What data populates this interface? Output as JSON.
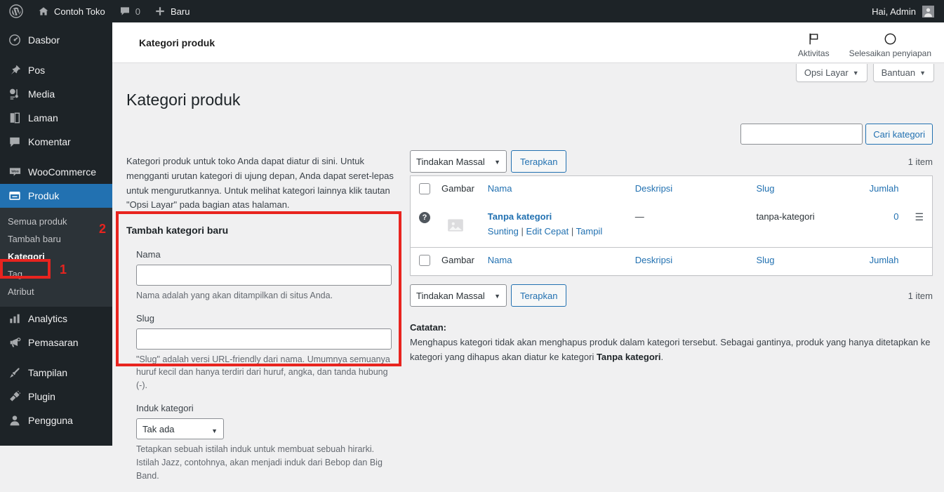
{
  "adminbar": {
    "logo_icon": "wordpress-logo-icon",
    "site_icon": "home-icon",
    "site_name": "Contoh Toko",
    "comments_icon": "comment-bubble-icon",
    "comments_count": "0",
    "new_icon": "plus-icon",
    "new_label": "Baru",
    "greeting": "Hai, Admin",
    "avatar_icon": "user-avatar-icon"
  },
  "sidebar": {
    "items": [
      {
        "label": "Dasbor",
        "icon": "dashboard-icon",
        "current": false
      },
      {
        "label": "Pos",
        "icon": "pin-icon",
        "current": false
      },
      {
        "label": "Media",
        "icon": "media-icon",
        "current": false
      },
      {
        "label": "Laman",
        "icon": "page-icon",
        "current": false
      },
      {
        "label": "Komentar",
        "icon": "comment-icon",
        "current": false
      },
      {
        "label": "WooCommerce",
        "icon": "woocommerce-icon",
        "current": false
      },
      {
        "label": "Produk",
        "icon": "products-box-icon",
        "current": true
      },
      {
        "label": "Analytics",
        "icon": "bar-chart-icon",
        "current": false
      },
      {
        "label": "Pemasaran",
        "icon": "megaphone-icon",
        "current": false
      },
      {
        "label": "Tampilan",
        "icon": "paintbrush-icon",
        "current": false
      },
      {
        "label": "Plugin",
        "icon": "plug-icon",
        "current": false
      },
      {
        "label": "Pengguna",
        "icon": "user-icon",
        "current": false
      }
    ],
    "submenu": [
      {
        "label": "Semua produk",
        "current": false
      },
      {
        "label": "Tambah baru",
        "current": false
      },
      {
        "label": "Kategori",
        "current": true
      },
      {
        "label": "Tag",
        "current": false
      },
      {
        "label": "Atribut",
        "current": false
      }
    ]
  },
  "annotations": {
    "marker_one": "1",
    "marker_two": "2",
    "color": "#e8241f"
  },
  "wc_topbar": {
    "title": "Kategori produk",
    "actions": [
      {
        "label": "Aktivitas",
        "icon": "flag-icon"
      },
      {
        "label": "Selesaikan penyiapan",
        "icon": "circle-progress-icon"
      }
    ]
  },
  "screen_meta": {
    "screen_options": "Opsi Layar",
    "help": "Bantuan",
    "caret_icon": "chevron-down-icon"
  },
  "page": {
    "title": "Kategori produk"
  },
  "search": {
    "value": "",
    "placeholder": "",
    "button_label": "Cari kategori"
  },
  "left_column": {
    "intro": "Kategori produk untuk toko Anda dapat diatur di sini. Untuk mengganti urutan kategori di ujung depan, Anda dapat seret-lepas untuk mengurutkannya. Untuk melihat kategori lainnya klik tautan \"Opsi Layar\" pada bagian atas halaman.",
    "form_heading": "Tambah kategori baru",
    "fields": {
      "name_label": "Nama",
      "name_value": "",
      "name_desc": "Nama adalah yang akan ditampilkan di situs Anda.",
      "slug_label": "Slug",
      "slug_value": "",
      "slug_desc": "\"Slug\" adalah versi URL-friendly dari nama. Umumnya semuanya huruf kecil dan hanya terdiri dari huruf, angka, dan tanda hubung (-).",
      "parent_label": "Induk kategori",
      "parent_value": "Tak ada",
      "parent_desc": "Tetapkan sebuah istilah induk untuk membuat sebuah hirarki. Istilah Jazz, contohnya, akan menjadi induk dari Bebop dan Big Band."
    }
  },
  "table": {
    "bulk_actions_value": "Tindakan Massal",
    "apply_label": "Terapkan",
    "item_count": "1 item",
    "columns": [
      {
        "label": "",
        "name": "select-all"
      },
      {
        "label": "Gambar",
        "name": "image",
        "sortable": false
      },
      {
        "label": "Nama",
        "name": "name",
        "sortable": true
      },
      {
        "label": "Deskripsi",
        "name": "description",
        "sortable": true
      },
      {
        "label": "Slug",
        "name": "slug",
        "sortable": true
      },
      {
        "label": "Jumlah",
        "name": "count",
        "sortable": true
      }
    ],
    "rows": [
      {
        "help_icon": "help-question-icon",
        "thumb_icon": "image-placeholder-icon",
        "name": "Tanpa kategori",
        "actions": [
          "Sunting",
          "Edit Cepat",
          "Tampil"
        ],
        "action_separator": "|",
        "description": "—",
        "slug": "tanpa-kategori",
        "count": "0",
        "handle_icon": "drag-handle-icon"
      }
    ]
  },
  "note": {
    "heading": "Catatan:",
    "text_before": "Menghapus kategori tidak akan menghapus produk dalam kategori tersebut. Sebagai gantinya, produk yang hanya ditetapkan ke kategori yang dihapus akan diatur ke kategori ",
    "bold_term": "Tanpa kategori",
    "text_after": "."
  }
}
